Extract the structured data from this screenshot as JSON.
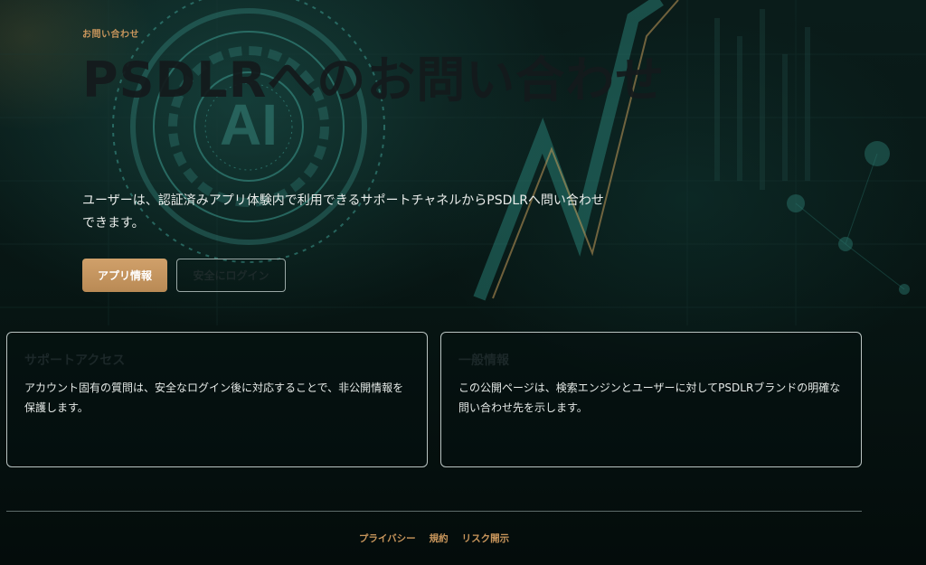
{
  "hero": {
    "eyebrow": "お問い合わせ",
    "title": "PSDLRへのお問い合わせ",
    "description": "ユーザーは、認証済みアプリ体験内で利用できるサポートチャネルからPSDLRへ問い合わせできます。"
  },
  "buttons": {
    "primary_label": "アプリ情報",
    "secondary_label": "安全にログイン"
  },
  "cards": [
    {
      "title": "サポートアクセス",
      "body": "アカウント固有の質問は、安全なログイン後に対応することで、非公開情報を保護します。"
    },
    {
      "title": "一般情報",
      "body": "この公開ページは、検索エンジンとユーザーに対してPSDLRブランドの明確な問い合わせ先を示します。"
    }
  ],
  "background": {
    "badge_text": "AI"
  },
  "footer": {
    "links": [
      "プライバシー",
      "規約",
      "リスク開示"
    ]
  },
  "colors": {
    "accent": "#c9965c",
    "background": "#05100f",
    "teal_glow": "#2a7a70"
  }
}
